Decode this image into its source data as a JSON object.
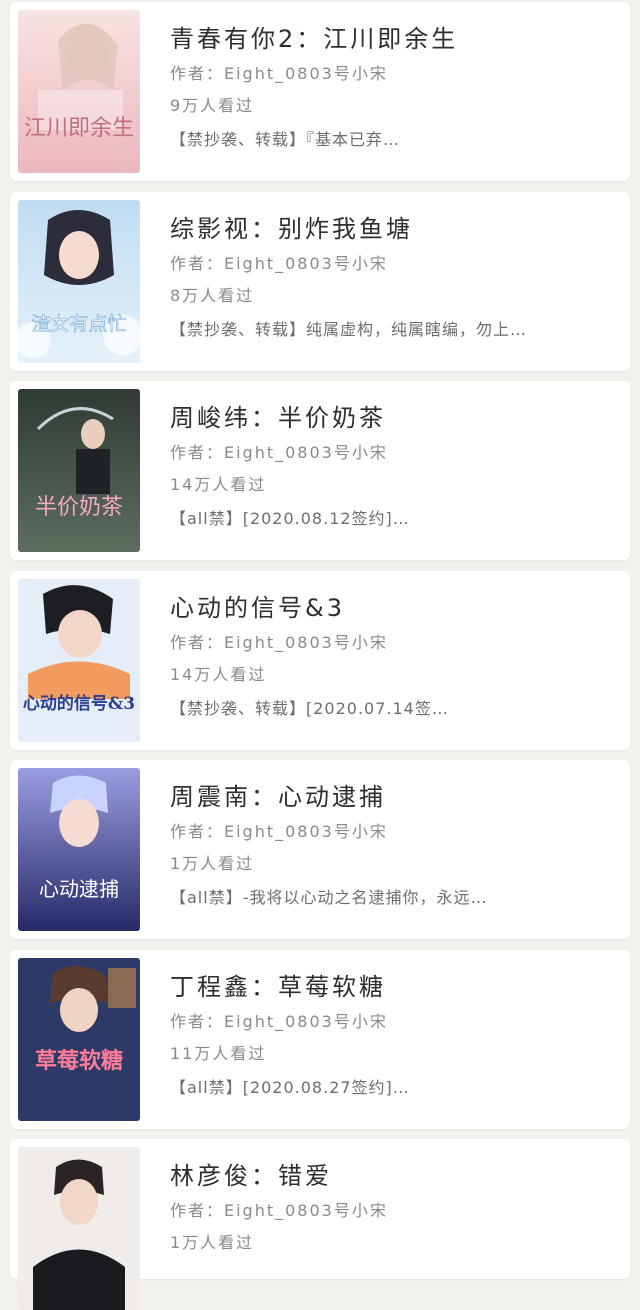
{
  "books": [
    {
      "title": "青春有你2：江川即余生",
      "author_line": "作者：Eight_0803号小宋",
      "reads": "9万人看过",
      "desc": "【禁抄袭、转载】『基本已弃…",
      "cover_text": "江川即余生",
      "cover_colors": [
        "#f7d6d6",
        "#e9b8bd"
      ]
    },
    {
      "title": "综影视：别炸我鱼塘",
      "author_line": "作者：Eight_0803号小宋",
      "reads": "8万人看过",
      "desc": "【禁抄袭、转载】纯属虚构，纯属瞎编，勿上…",
      "cover_text": "渣女有点忙",
      "cover_colors": [
        "#cfe6f5",
        "#9fc9ea"
      ]
    },
    {
      "title": "周峻纬：半价奶茶",
      "author_line": "作者：Eight_0803号小宋",
      "reads": "14万人看过",
      "desc": "【all禁】[2020.08.12签约]…",
      "cover_text": "半价奶茶",
      "cover_colors": [
        "#3d4a3f",
        "#8aa08c"
      ]
    },
    {
      "title": "心动的信号&3",
      "author_line": "作者：Eight_0803号小宋",
      "reads": "14万人看过",
      "desc": "【禁抄袭、转载】[2020.07.14签…",
      "cover_text": "心动的信号&3",
      "cover_colors": [
        "#dfe9f7",
        "#f4a26a"
      ]
    },
    {
      "title": "周震南：心动逮捕",
      "author_line": "作者：Eight_0803号小宋",
      "reads": "1万人看过",
      "desc": "【all禁】-我将以心动之名逮捕你，永远…",
      "cover_text": "心动逮捕",
      "cover_colors": [
        "#2b2f6e",
        "#8f8fd6"
      ]
    },
    {
      "title": "丁程鑫：草莓软糖",
      "author_line": "作者：Eight_0803号小宋",
      "reads": "11万人看过",
      "desc": "【all禁】[2020.08.27签约]…",
      "cover_text": "草莓软糖",
      "cover_colors": [
        "#2c3a6b",
        "#e2607a"
      ]
    },
    {
      "title": "林彦俊：错爱",
      "author_line": "作者：Eight_0803号小宋",
      "reads": "1万人看过",
      "desc": "",
      "cover_text": "",
      "cover_colors": [
        "#f2f0ee",
        "#d9d4d0"
      ]
    }
  ]
}
